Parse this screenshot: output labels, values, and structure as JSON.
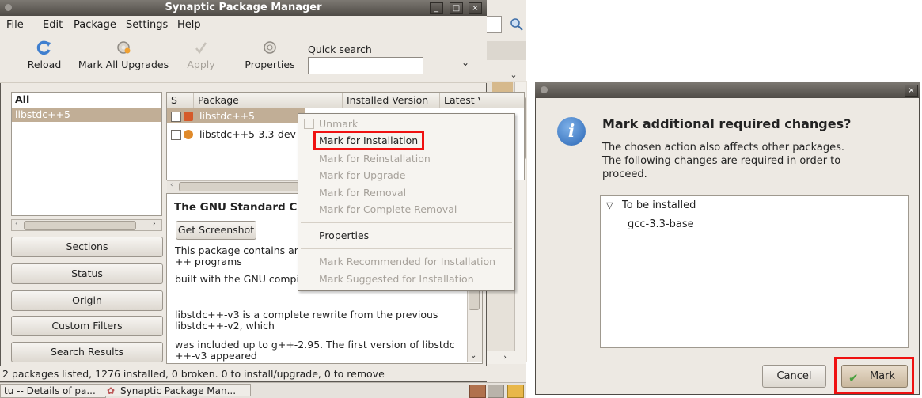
{
  "synaptic": {
    "title": "Synaptic Package Manager",
    "window_buttons": [
      "_",
      "□",
      "×"
    ],
    "menu": [
      "File",
      "Edit",
      "Package",
      "Settings",
      "Help"
    ],
    "toolbar": {
      "reload": "Reload",
      "mark_all_upgrades": "Mark All Upgrades",
      "apply": "Apply",
      "properties": "Properties",
      "quick_search_label": "Quick search",
      "quick_search_value": ""
    },
    "filters": {
      "all": "All",
      "selected": "libstdc++5"
    },
    "side_buttons": [
      "Sections",
      "Status",
      "Origin",
      "Custom Filters",
      "Search Results"
    ],
    "table": {
      "headers": [
        "S",
        "Package",
        "Installed Version",
        "Latest V"
      ],
      "rows": [
        {
          "name": "libstdc++5",
          "selected": true
        },
        {
          "name": "libstdc++5-3.3-dev",
          "selected": false
        }
      ]
    },
    "description": {
      "title": "The GNU Standard C",
      "screenshot_button": "Get Screenshot",
      "lines": [
        "This package contains an",
        "++ programs",
        "built with the GNU compi",
        "libstdc++-v3 is a complete rewrite from the previous",
        "libstdc++-v2, which",
        "was included up to g++-2.95. The first version of libstdc",
        "++-v3 appeared"
      ]
    },
    "status": "2 packages listed, 1276 installed, 0 broken. 0 to install/upgrade, 0 to remove",
    "context_menu": [
      {
        "label": "Unmark",
        "enabled": false
      },
      {
        "label": "Mark for Installation",
        "enabled": true,
        "highlighted": true
      },
      {
        "label": "Mark for Reinstallation",
        "enabled": false
      },
      {
        "label": "Mark for Upgrade",
        "enabled": false
      },
      {
        "label": "Mark for Removal",
        "enabled": false
      },
      {
        "label": "Mark for Complete Removal",
        "enabled": false
      },
      {
        "label": "Properties",
        "enabled": true
      },
      {
        "label": "Mark Recommended for Installation",
        "enabled": false
      },
      {
        "label": "Mark Suggested for Installation",
        "enabled": false
      }
    ]
  },
  "taskbar": {
    "items": [
      "tu -- Details of pa...",
      "Synaptic Package Man..."
    ]
  },
  "dialog": {
    "close": "×",
    "heading": "Mark additional required changes?",
    "body_lines": [
      "The chosen action also affects other packages.",
      "The following changes are required in order to",
      "proceed."
    ],
    "tree_parent": "To be installed",
    "tree_child": "gcc-3.3-base",
    "cancel_label": "Cancel",
    "mark_label": "Mark"
  },
  "colors": {
    "selection": "#c1ae96",
    "highlight": "#ef1111",
    "window_bg": "#ede9e3"
  }
}
